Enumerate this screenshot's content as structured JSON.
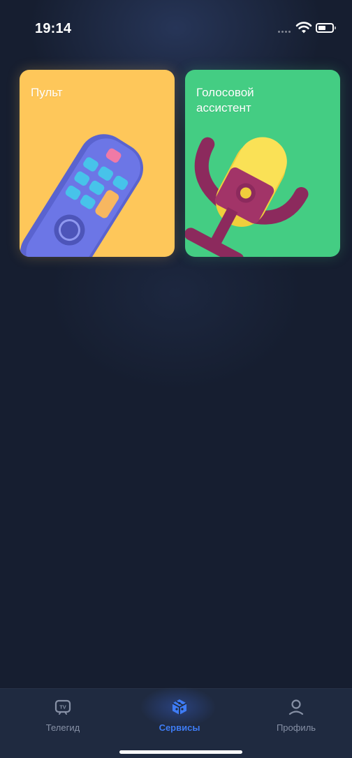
{
  "status_bar": {
    "time": "19:14",
    "icons": [
      "signal-dots-icon",
      "wifi-icon",
      "battery-icon"
    ]
  },
  "services": [
    {
      "id": "remote",
      "title": "Пульт",
      "color": "#fec75a",
      "icon": "remote-control-icon"
    },
    {
      "id": "voice_assistant",
      "title": "Голосовой\nассистент",
      "color": "#44cd83",
      "icon": "microphone-icon"
    }
  ],
  "bottom_nav": {
    "active": "services",
    "accent": "#3e7cf6",
    "inactive_color": "#8791a6",
    "items": [
      {
        "id": "tv_guide",
        "label": "Телегид",
        "icon": "tv-icon"
      },
      {
        "id": "services",
        "label": "Сервисы",
        "icon": "cube-icon"
      },
      {
        "id": "profile",
        "label": "Профиль",
        "icon": "user-icon"
      }
    ]
  },
  "colors": {
    "background": "#161e30",
    "nav_background": "#1f2a40"
  }
}
